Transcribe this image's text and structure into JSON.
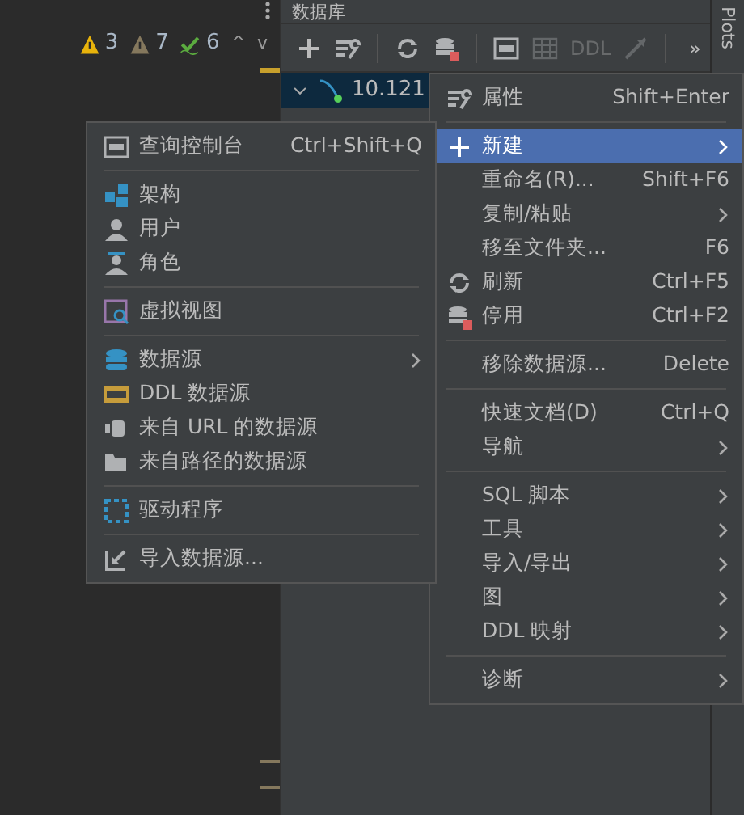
{
  "editor": {
    "inspections": [
      {
        "kind": "warning",
        "count": "3"
      },
      {
        "kind": "weak",
        "count": "7"
      },
      {
        "kind": "typo",
        "count": "6"
      }
    ],
    "nav": [
      "^",
      "v"
    ]
  },
  "panel": {
    "title": "数据库",
    "toolbar": [
      {
        "kind": "add",
        "disabled": false
      },
      {
        "kind": "properties",
        "disabled": false
      },
      {
        "kind": "sep"
      },
      {
        "kind": "refresh",
        "disabled": false
      },
      {
        "kind": "disable",
        "disabled": false
      },
      {
        "kind": "sep"
      },
      {
        "kind": "console",
        "disabled": false
      },
      {
        "kind": "table",
        "disabled": true
      },
      {
        "kind": "ddl",
        "label": "DDL",
        "disabled": true
      },
      {
        "kind": "jump",
        "disabled": true
      },
      {
        "kind": "sep"
      },
      {
        "kind": "more",
        "label": "»",
        "disabled": false
      }
    ],
    "tree": [
      {
        "label": "10.121",
        "selected": true,
        "expanded": true
      }
    ]
  },
  "side_strip": {
    "label": "Plots"
  },
  "context_menu": [
    {
      "kind": "properties",
      "label": "属性",
      "shortcut": "Shift+Enter",
      "submenu": false,
      "selected": false
    },
    {
      "kind": "sep"
    },
    {
      "kind": "add",
      "label": "新建",
      "submenu": true,
      "selected": true
    },
    {
      "kind": "plain",
      "label": "重命名(R)...",
      "shortcut": "Shift+F6",
      "submenu": false,
      "selected": false
    },
    {
      "kind": "plain",
      "label": "复制/粘贴",
      "submenu": true,
      "selected": false
    },
    {
      "kind": "plain",
      "label": "移至文件夹...",
      "shortcut": "F6",
      "submenu": false,
      "selected": false
    },
    {
      "kind": "refresh",
      "label": "刷新",
      "shortcut": "Ctrl+F5",
      "submenu": false,
      "selected": false
    },
    {
      "kind": "disable",
      "label": "停用",
      "shortcut": "Ctrl+F2",
      "submenu": false,
      "selected": false
    },
    {
      "kind": "sep"
    },
    {
      "kind": "plain",
      "label": "移除数据源...",
      "shortcut": "Delete",
      "submenu": false,
      "selected": false
    },
    {
      "kind": "sep"
    },
    {
      "kind": "plain",
      "label": "快速文档(D)",
      "shortcut": "Ctrl+Q",
      "submenu": false,
      "selected": false
    },
    {
      "kind": "plain",
      "label": "导航",
      "submenu": true,
      "selected": false
    },
    {
      "kind": "sep"
    },
    {
      "kind": "plain",
      "label": "SQL 脚本",
      "submenu": true,
      "selected": false
    },
    {
      "kind": "plain",
      "label": "工具",
      "submenu": true,
      "selected": false
    },
    {
      "kind": "plain",
      "label": "导入/导出",
      "submenu": true,
      "selected": false
    },
    {
      "kind": "plain",
      "label": "图",
      "submenu": true,
      "selected": false
    },
    {
      "kind": "plain",
      "label": "DDL 映射",
      "submenu": true,
      "selected": false
    },
    {
      "kind": "sep"
    },
    {
      "kind": "plain",
      "label": "诊断",
      "submenu": true,
      "selected": false
    }
  ],
  "new_submenu": [
    {
      "kind": "console",
      "label": "查询控制台",
      "shortcut": "Ctrl+Shift+Q",
      "submenu": false,
      "selected": false
    },
    {
      "kind": "sep"
    },
    {
      "kind": "schema",
      "label": "架构",
      "submenu": false,
      "selected": false
    },
    {
      "kind": "user",
      "label": "用户",
      "submenu": false,
      "selected": false
    },
    {
      "kind": "role",
      "label": "角色",
      "submenu": false,
      "selected": false
    },
    {
      "kind": "sep"
    },
    {
      "kind": "view",
      "label": "虚拟视图",
      "submenu": false,
      "selected": false
    },
    {
      "kind": "sep"
    },
    {
      "kind": "datasource",
      "label": "数据源",
      "submenu": true,
      "selected": false
    },
    {
      "kind": "ddl",
      "label": "DDL 数据源",
      "submenu": false,
      "selected": false
    },
    {
      "kind": "plug",
      "label": "来自 URL 的数据源",
      "submenu": false,
      "selected": false
    },
    {
      "kind": "folder",
      "label": "来自路径的数据源",
      "submenu": false,
      "selected": false
    },
    {
      "kind": "sep"
    },
    {
      "kind": "driver",
      "label": "驱动程序",
      "submenu": false,
      "selected": false
    },
    {
      "kind": "sep"
    },
    {
      "kind": "import",
      "label": "导入数据源...",
      "submenu": false,
      "selected": false
    }
  ]
}
